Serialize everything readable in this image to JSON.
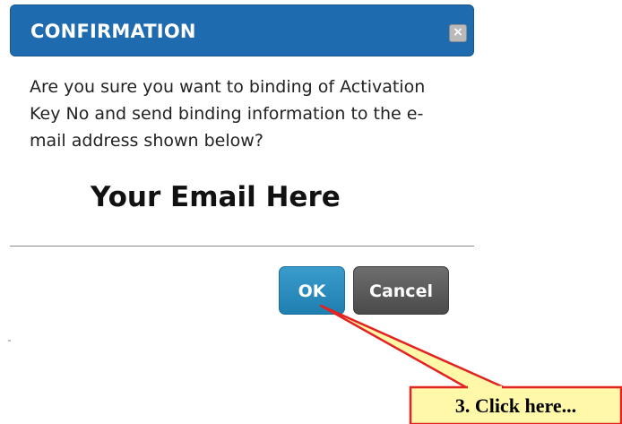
{
  "dialog": {
    "title": "CONFIRMATION",
    "close_glyph": "×",
    "message": "Are you sure you want to binding of Activation Key No and send binding information to the e-mail address shown below?",
    "email": "Your Email Here",
    "ok_label": "OK",
    "cancel_label": "Cancel"
  },
  "callout": {
    "text": "3. Click here..."
  },
  "colors": {
    "header": "#1f6bb0",
    "ok_button": "#2a8dbf",
    "cancel_button": "#5a5a5a",
    "callout_fill": "#fff8a8",
    "callout_border": "#e32222"
  }
}
